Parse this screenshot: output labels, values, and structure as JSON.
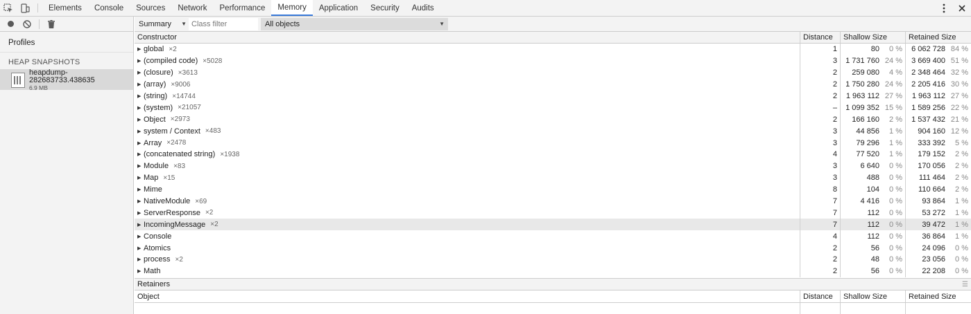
{
  "tabs": [
    {
      "label": "Elements",
      "active": false
    },
    {
      "label": "Console",
      "active": false
    },
    {
      "label": "Sources",
      "active": false
    },
    {
      "label": "Network",
      "active": false
    },
    {
      "label": "Performance",
      "active": false
    },
    {
      "label": "Memory",
      "active": true
    },
    {
      "label": "Application",
      "active": false
    },
    {
      "label": "Security",
      "active": false
    },
    {
      "label": "Audits",
      "active": false
    }
  ],
  "left": {
    "profiles_label": "Profiles",
    "section_title": "HEAP SNAPSHOTS",
    "snapshot": {
      "name": "heapdump-282683733.438635",
      "size": "6.9 MB"
    }
  },
  "toolbar": {
    "view": "Summary",
    "filter_placeholder": "Class filter",
    "objects": "All objects"
  },
  "grid": {
    "columns": [
      "Constructor",
      "Distance",
      "Shallow Size",
      "Retained Size"
    ],
    "rows": [
      {
        "name": "global",
        "count": "×2",
        "distance": "1",
        "shallow": "80",
        "shallow_pct": "0 %",
        "retained": "6 062 728",
        "retained_pct": "84 %"
      },
      {
        "name": "(compiled code)",
        "count": "×5028",
        "distance": "3",
        "shallow": "1 731 760",
        "shallow_pct": "24 %",
        "retained": "3 669 400",
        "retained_pct": "51 %"
      },
      {
        "name": "(closure)",
        "count": "×3613",
        "distance": "2",
        "shallow": "259 080",
        "shallow_pct": "4 %",
        "retained": "2 348 464",
        "retained_pct": "32 %"
      },
      {
        "name": "(array)",
        "count": "×9006",
        "distance": "2",
        "shallow": "1 750 280",
        "shallow_pct": "24 %",
        "retained": "2 205 416",
        "retained_pct": "30 %"
      },
      {
        "name": "(string)",
        "count": "×14744",
        "distance": "2",
        "shallow": "1 963 112",
        "shallow_pct": "27 %",
        "retained": "1 963 112",
        "retained_pct": "27 %"
      },
      {
        "name": "(system)",
        "count": "×21057",
        "distance": "–",
        "shallow": "1 099 352",
        "shallow_pct": "15 %",
        "retained": "1 589 256",
        "retained_pct": "22 %"
      },
      {
        "name": "Object",
        "count": "×2973",
        "distance": "2",
        "shallow": "166 160",
        "shallow_pct": "2 %",
        "retained": "1 537 432",
        "retained_pct": "21 %"
      },
      {
        "name": "system / Context",
        "count": "×483",
        "distance": "3",
        "shallow": "44 856",
        "shallow_pct": "1 %",
        "retained": "904 160",
        "retained_pct": "12 %"
      },
      {
        "name": "Array",
        "count": "×2478",
        "distance": "3",
        "shallow": "79 296",
        "shallow_pct": "1 %",
        "retained": "333 392",
        "retained_pct": "5 %"
      },
      {
        "name": "(concatenated string)",
        "count": "×1938",
        "distance": "4",
        "shallow": "77 520",
        "shallow_pct": "1 %",
        "retained": "179 152",
        "retained_pct": "2 %"
      },
      {
        "name": "Module",
        "count": "×83",
        "distance": "3",
        "shallow": "6 640",
        "shallow_pct": "0 %",
        "retained": "170 056",
        "retained_pct": "2 %"
      },
      {
        "name": "Map",
        "count": "×15",
        "distance": "3",
        "shallow": "488",
        "shallow_pct": "0 %",
        "retained": "111 464",
        "retained_pct": "2 %"
      },
      {
        "name": "Mime",
        "count": "",
        "distance": "8",
        "shallow": "104",
        "shallow_pct": "0 %",
        "retained": "110 664",
        "retained_pct": "2 %"
      },
      {
        "name": "NativeModule",
        "count": "×69",
        "distance": "7",
        "shallow": "4 416",
        "shallow_pct": "0 %",
        "retained": "93 864",
        "retained_pct": "1 %"
      },
      {
        "name": "ServerResponse",
        "count": "×2",
        "distance": "7",
        "shallow": "112",
        "shallow_pct": "0 %",
        "retained": "53 272",
        "retained_pct": "1 %"
      },
      {
        "name": "IncomingMessage",
        "count": "×2",
        "distance": "7",
        "shallow": "112",
        "shallow_pct": "0 %",
        "retained": "39 472",
        "retained_pct": "1 %",
        "highlight": true
      },
      {
        "name": "Console",
        "count": "",
        "distance": "4",
        "shallow": "112",
        "shallow_pct": "0 %",
        "retained": "36 864",
        "retained_pct": "1 %"
      },
      {
        "name": "Atomics",
        "count": "",
        "distance": "2",
        "shallow": "56",
        "shallow_pct": "0 %",
        "retained": "24 096",
        "retained_pct": "0 %"
      },
      {
        "name": "process",
        "count": "×2",
        "distance": "2",
        "shallow": "48",
        "shallow_pct": "0 %",
        "retained": "23 056",
        "retained_pct": "0 %"
      },
      {
        "name": "Math",
        "count": "",
        "distance": "2",
        "shallow": "56",
        "shallow_pct": "0 %",
        "retained": "22 208",
        "retained_pct": "0 %"
      }
    ]
  },
  "retainers": {
    "title": "Retainers",
    "columns": [
      "Object",
      "Distance",
      "Shallow Size",
      "Retained Size"
    ]
  }
}
